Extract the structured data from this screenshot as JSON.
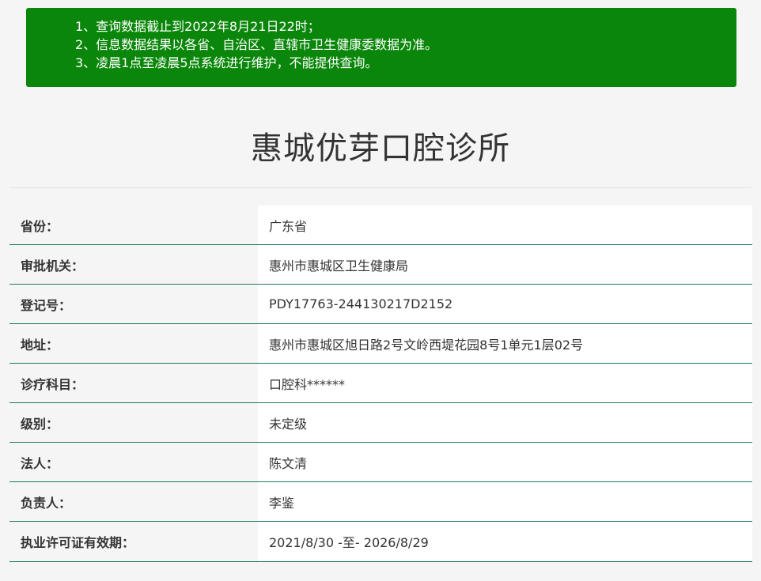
{
  "notice": {
    "lines": [
      "1、查询数据截止到2022年8月21日22时；",
      "2、信息数据结果以各省、自治区、直辖市卫生健康委数据为准。",
      "3、凌晨1点至凌晨5点系统进行维护，不能提供查询。"
    ]
  },
  "title": "惠城优芽口腔诊所",
  "rows": [
    {
      "label": "省份：",
      "value": "广东省"
    },
    {
      "label": "审批机关：",
      "value": "惠州市惠城区卫生健康局"
    },
    {
      "label": "登记号：",
      "value": "PDY17763-244130217D2152"
    },
    {
      "label": "地址：",
      "value": "惠州市惠城区旭日路2号文岭西堤花园8号1单元1层02号"
    },
    {
      "label": "诊疗科目：",
      "value": "口腔科******"
    },
    {
      "label": "级别：",
      "value": "未定级"
    },
    {
      "label": "法人：",
      "value": "陈文清"
    },
    {
      "label": "负责人：",
      "value": "李鉴"
    },
    {
      "label": "执业许可证有效期：",
      "value": "2021/8/30 -至- 2026/8/29"
    }
  ],
  "colors": {
    "notice_bg": "#0a870a",
    "row_border": "#1f7a54"
  }
}
